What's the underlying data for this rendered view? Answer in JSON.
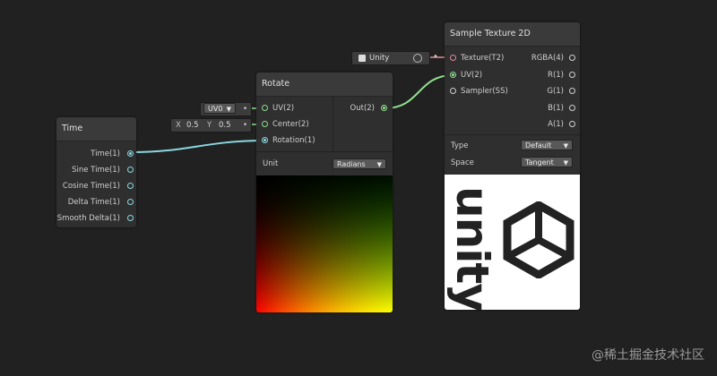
{
  "time_node": {
    "title": "Time",
    "outputs": [
      "Time(1)",
      "Sine Time(1)",
      "Cosine Time(1)",
      "Delta Time(1)",
      "Smooth Delta(1)"
    ]
  },
  "rotate_node": {
    "title": "Rotate",
    "inputs": [
      "UV(2)",
      "Center(2)",
      "Rotation(1)"
    ],
    "output": "Out(2)",
    "unit_label": "Unit",
    "unit_value": "Radians"
  },
  "uv_field": {
    "value": "UV0"
  },
  "center_field": {
    "x_label": "X",
    "x_value": "0.5",
    "y_label": "Y",
    "y_value": "0.5"
  },
  "texture_field": {
    "label": "Unity"
  },
  "sample_node": {
    "title": "Sample Texture 2D",
    "inputs": [
      "Texture(T2)",
      "UV(2)",
      "Sampler(SS)"
    ],
    "outputs": [
      "RGBA(4)",
      "R(1)",
      "G(1)",
      "B(1)",
      "A(1)"
    ],
    "type_label": "Type",
    "type_value": "Default",
    "space_label": "Space",
    "space_value": "Tangent",
    "preview_text": "unity"
  },
  "watermark": "@稀土掘金技术社区",
  "colors": {
    "background": "#212121",
    "node": "#2f2f2f",
    "header": "#3a3a3a",
    "wire_cyan": "#8ad8e0",
    "wire_green": "#8ee08e"
  }
}
